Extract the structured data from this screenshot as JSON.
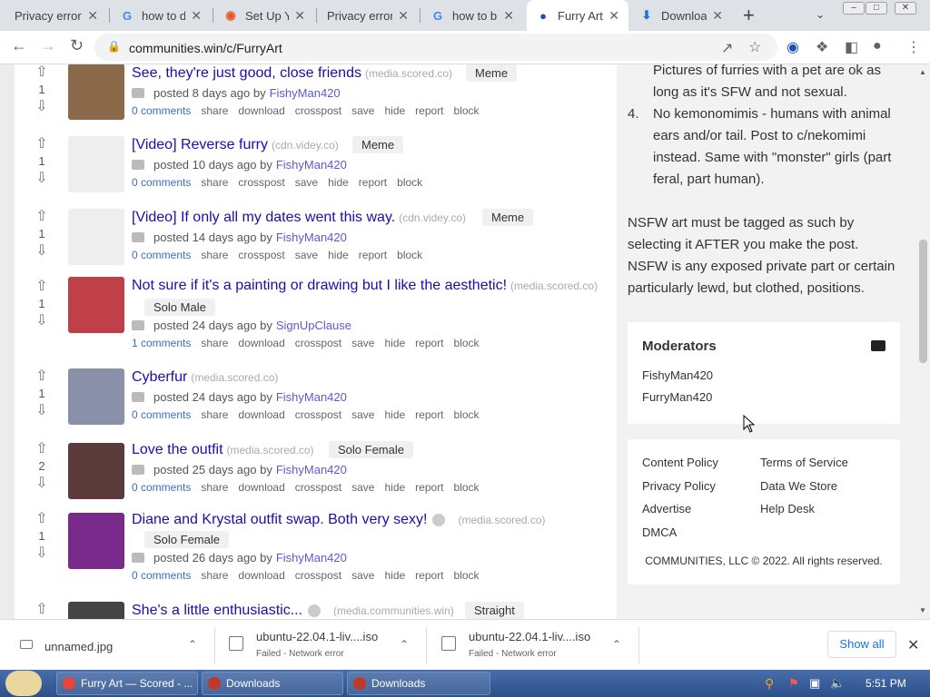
{
  "tabs": [
    {
      "title": "Privacy error",
      "icon": "warning-icon"
    },
    {
      "title": "how to dow",
      "icon": "google-icon"
    },
    {
      "title": "Set Up Yo",
      "icon": "ubuntu-icon"
    },
    {
      "title": "Privacy error",
      "icon": "warning-icon"
    },
    {
      "title": "how to bu",
      "icon": "google-icon"
    },
    {
      "title": "Furry Art",
      "icon": "communities-icon",
      "active": true
    },
    {
      "title": "Downloa",
      "icon": "download-icon"
    }
  ],
  "toolbar": {
    "url": "communities.win/c/FurryArt"
  },
  "posts": [
    {
      "title": "See, they're just good, close friends",
      "domain": "(media.scored.co)",
      "flair": "Meme",
      "score": "1",
      "meta": "posted 8 days ago by",
      "author": "FishyMan420",
      "comments": "0 comments",
      "actions": [
        "share",
        "download",
        "crosspost",
        "save",
        "hide",
        "report",
        "block"
      ],
      "thumb_color": "#8a6a4a"
    },
    {
      "title": "[Video] Reverse furry",
      "domain": "(cdn.videy.co)",
      "flair": "Meme",
      "score": "1",
      "meta": "posted 10 days ago by",
      "author": "FishyMan420",
      "comments": "0 comments",
      "actions": [
        "share",
        "crosspost",
        "save",
        "hide",
        "report",
        "block"
      ],
      "thumb_color": "#eeeeee"
    },
    {
      "title": "[Video] If only all my dates went this way.",
      "domain": "(cdn.videy.co)",
      "flair": "Meme",
      "score": "1",
      "meta": "posted 14 days ago by",
      "author": "FishyMan420",
      "comments": "0 comments",
      "actions": [
        "share",
        "crosspost",
        "save",
        "hide",
        "report",
        "block"
      ],
      "thumb_color": "#eeeeee"
    },
    {
      "title": "Not sure if it's a painting or drawing but I like the aesthetic!",
      "domain": "(media.scored.co)",
      "flair": "Solo Male",
      "score": "1",
      "meta": "posted 24 days ago by",
      "author": "SignUpClause",
      "comments": "1 comments",
      "actions": [
        "share",
        "download",
        "crosspost",
        "save",
        "hide",
        "report",
        "block"
      ],
      "thumb_color": "#c0404a"
    },
    {
      "title": "Cyberfur",
      "domain": "(media.scored.co)",
      "flair": "",
      "score": "1",
      "meta": "posted 24 days ago by",
      "author": "FishyMan420",
      "comments": "0 comments",
      "actions": [
        "share",
        "download",
        "crosspost",
        "save",
        "hide",
        "report",
        "block"
      ],
      "thumb_color": "#8a90a8"
    },
    {
      "title": "Love the outfit",
      "domain": "(media.scored.co)",
      "flair": "Solo Female",
      "score": "2",
      "meta": "posted 25 days ago by",
      "author": "FishyMan420",
      "comments": "0 comments",
      "actions": [
        "share",
        "download",
        "crosspost",
        "save",
        "hide",
        "report",
        "block"
      ],
      "thumb_color": "#5a3a3a"
    },
    {
      "title": "Diane and Krystal outfit swap. Both very sexy!",
      "domain": "(media.scored.co)",
      "flair": "Solo Female",
      "score": "1",
      "meta": "posted 26 days ago by",
      "author": "FishyMan420",
      "comments": "0 comments",
      "actions": [
        "share",
        "download",
        "crosspost",
        "save",
        "hide",
        "report",
        "block"
      ],
      "thumb_color": "#7a2a8a"
    },
    {
      "title": "She's a little enthusiastic...",
      "domain": "(media.communities.win)",
      "flair": "Straight",
      "score": "",
      "meta": "",
      "author": "",
      "comments": "",
      "actions": [],
      "thumb_color": "#444444"
    }
  ],
  "sidebar": {
    "rule_3_continued": "Pictures of furries with a pet are ok as long as it's SFW and not sexual.",
    "rule_4": "No kemonomimis - humans with animal ears and/or tail. Post to c/nekomimi instead. Same with \"monster\" girls (part feral, part human).",
    "nsfw_note": "NSFW art must be tagged as such by selecting it AFTER you make the post. NSFW is any exposed private part or certain particularly lewd, but clothed, positions.",
    "moderators_title": "Moderators",
    "moderators": [
      "FishyMan420",
      "FurryMan420"
    ],
    "footer_links": [
      [
        "Content Policy",
        "Terms of Service"
      ],
      [
        "Privacy Policy",
        "Data We Store"
      ],
      [
        "Advertise",
        "Help Desk"
      ],
      [
        "DMCA",
        ""
      ]
    ],
    "copyright": "COMMUNITIES, LLC © 2022. All rights reserved."
  },
  "downloads": [
    {
      "name": "unnamed.jpg",
      "status": ""
    },
    {
      "name": "ubuntu-22.04.1-liv....iso",
      "status": "Failed - Network error"
    },
    {
      "name": "ubuntu-22.04.1-liv....iso",
      "status": "Failed - Network error"
    }
  ],
  "show_all": "Show all",
  "taskbar": {
    "items": [
      "Furry Art — Scored - ...",
      "Downloads",
      "Downloads"
    ],
    "clock": "5:51 PM"
  }
}
